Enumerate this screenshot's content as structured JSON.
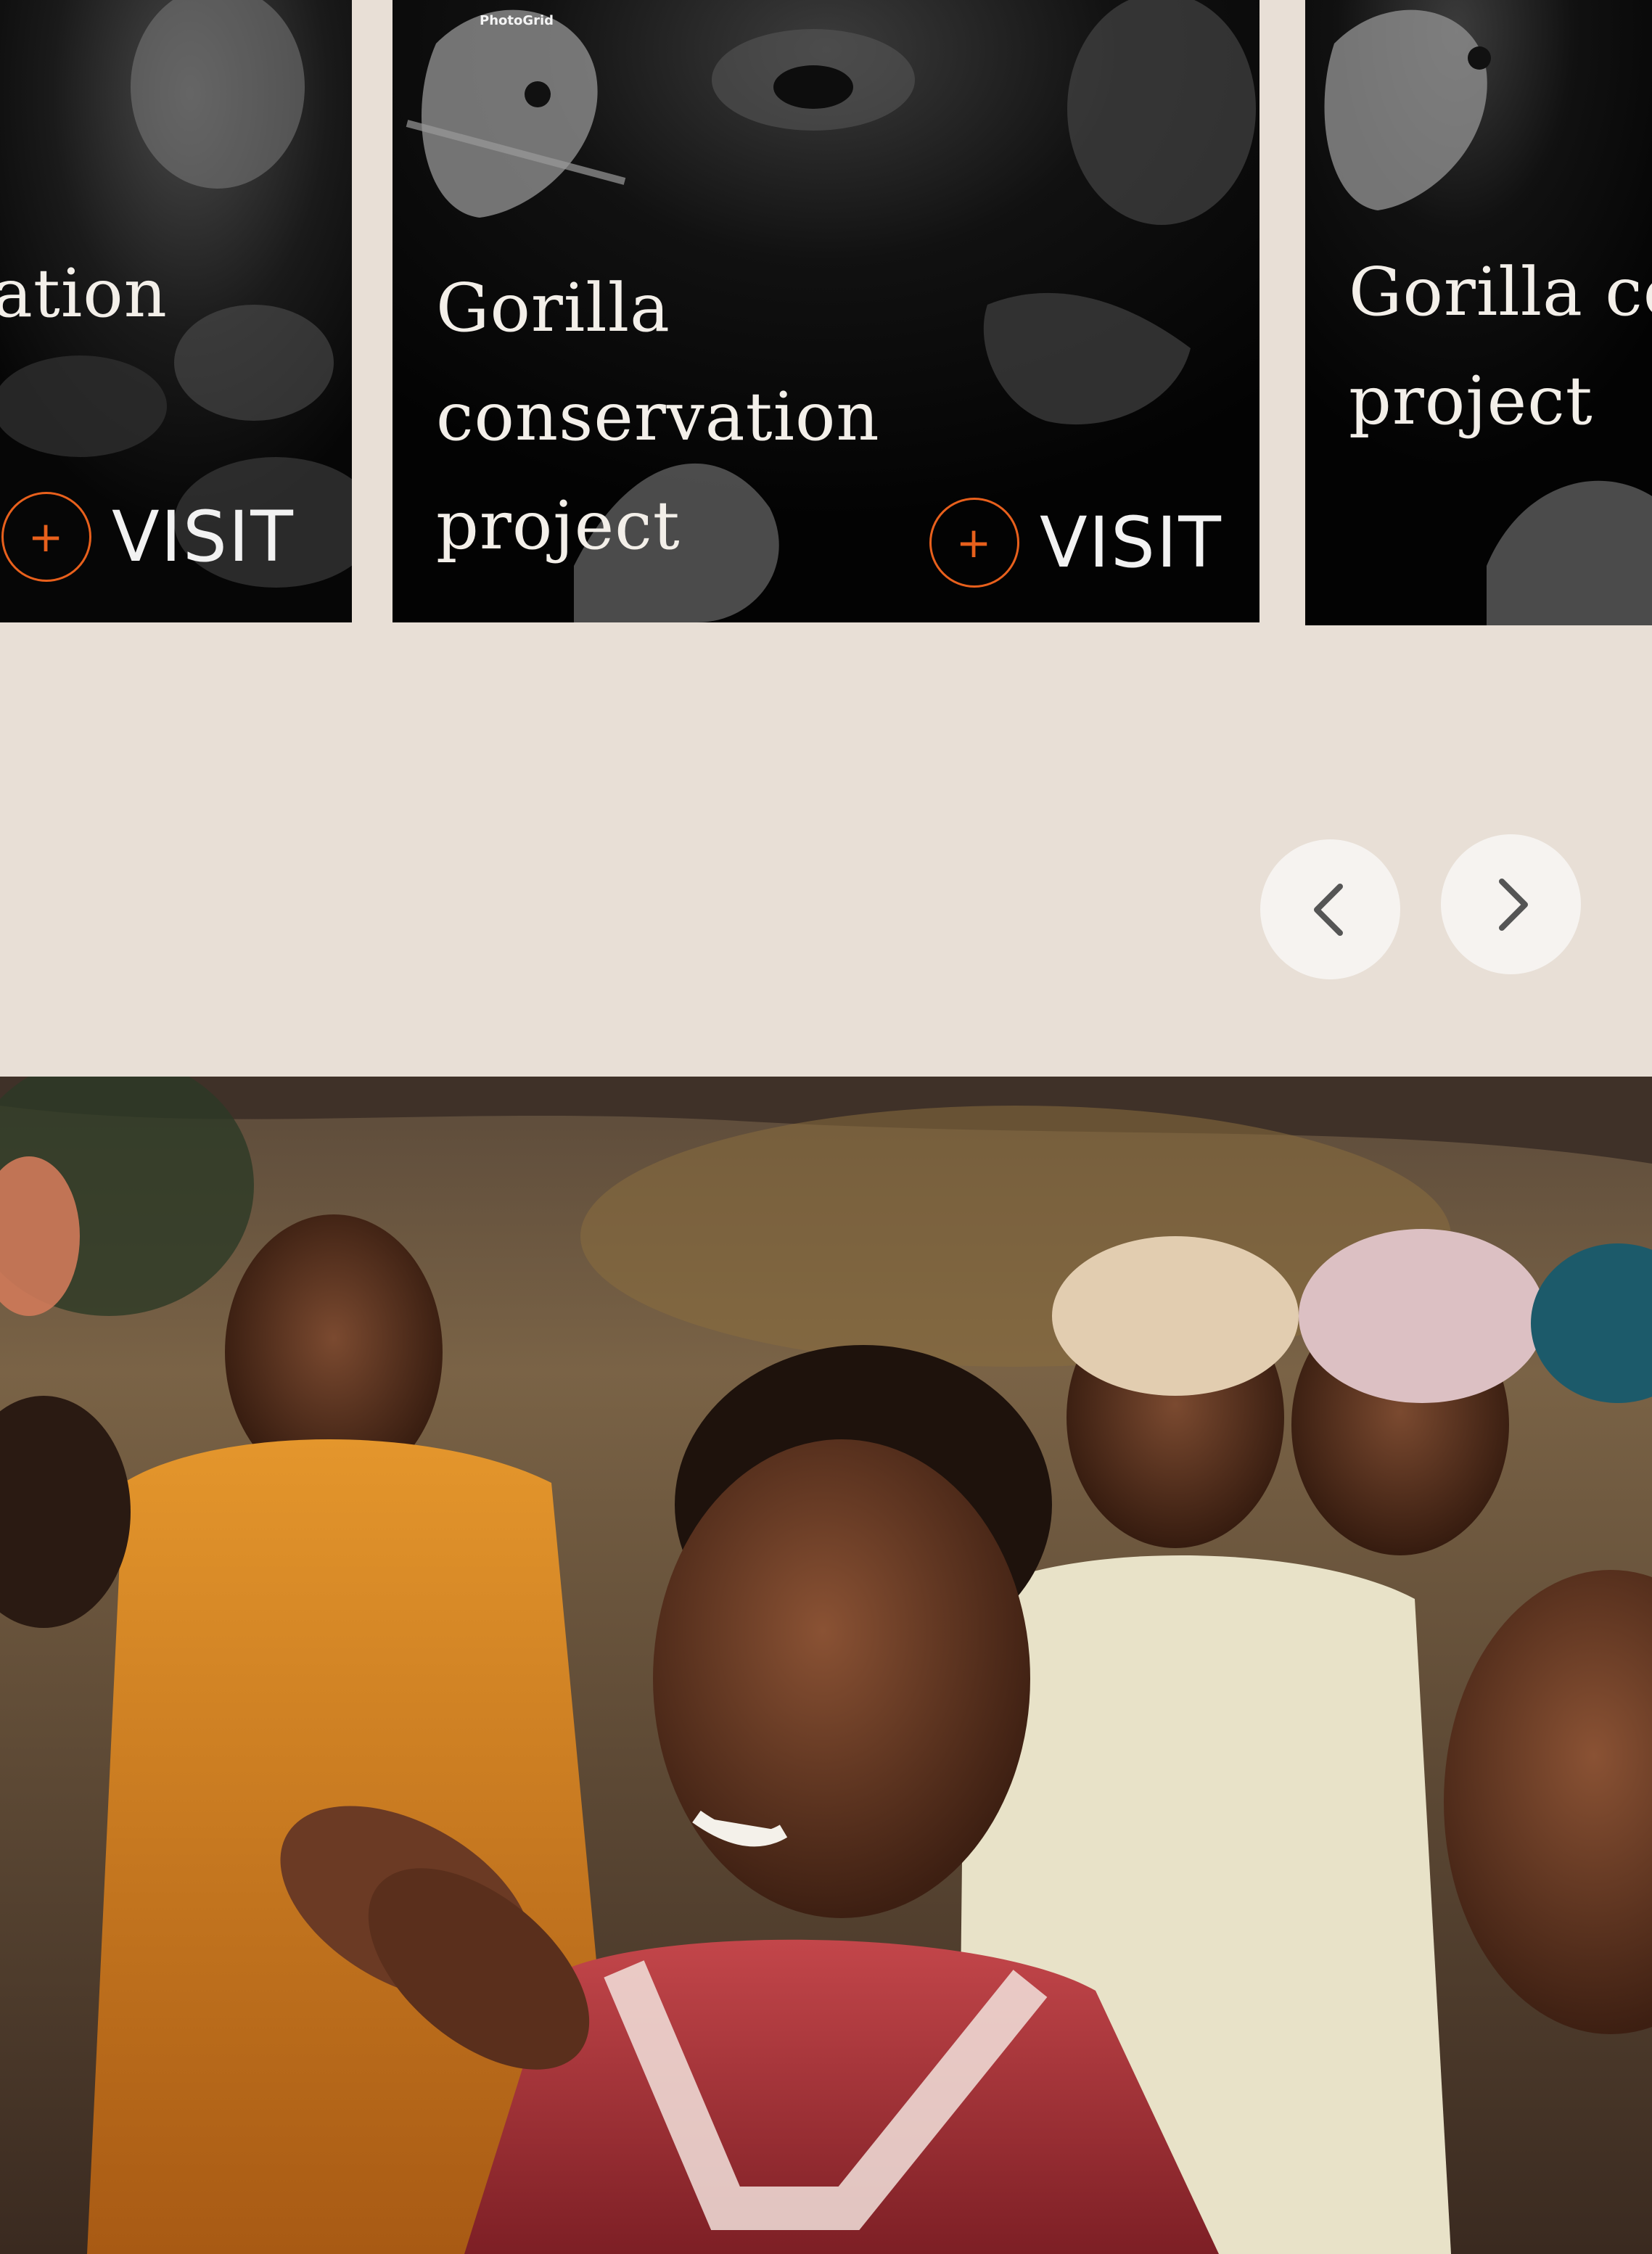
{
  "carousel": {
    "cards": [
      {
        "title": "Gorilla conservation project",
        "visible_title": "ation",
        "visit_label": "VISIT",
        "plus": "+"
      },
      {
        "title": "Gorilla conservation project",
        "visit_label": "VISIT",
        "plus": "+",
        "watermark": "PhotoGrid"
      },
      {
        "title": "Gorilla co project"
      }
    ],
    "nav": {
      "prev_icon": "chevron-left-icon",
      "next_icon": "chevron-right-icon"
    }
  },
  "colors": {
    "background": "#e8dfd6",
    "accent": "#e8601c",
    "card_bg": "#050505",
    "button_bg": "#f6f3f0"
  },
  "photo": {
    "subject": "community-photo"
  }
}
